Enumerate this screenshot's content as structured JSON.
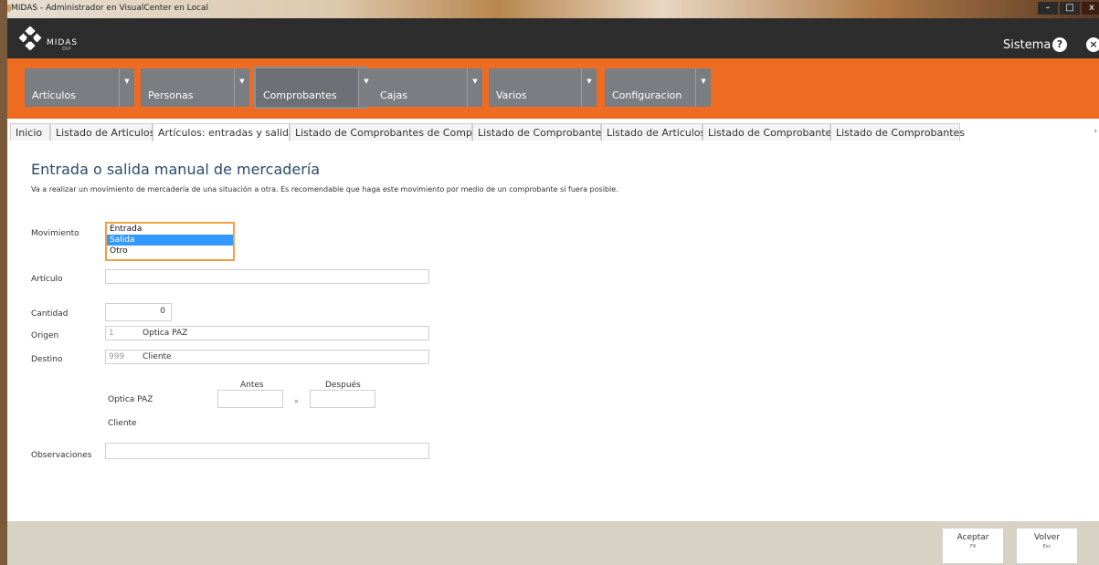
{
  "window": {
    "title": "MIDAS - Administrador en VisualCenter en Local",
    "controls": [
      "–",
      "□",
      "x"
    ]
  },
  "header": {
    "logo_text": "MIDAS",
    "logo_sub": "ERP",
    "sistema": "Sistema",
    "help": "?",
    "close": "×"
  },
  "menu": [
    {
      "label": "Artículos"
    },
    {
      "label": "Personas"
    },
    {
      "label": "Comprobantes"
    },
    {
      "label": "Cajas"
    },
    {
      "label": "Varios"
    },
    {
      "label": "Configuracion"
    }
  ],
  "menu_arrow": "▼",
  "tabs": [
    {
      "label": "Inicio"
    },
    {
      "label": "Listado de Articulos"
    },
    {
      "label": "Artículos: entradas y salidas"
    },
    {
      "label": "Listado de Comprobantes de Compras"
    },
    {
      "label": "Listado de Comprobantes"
    },
    {
      "label": "Listado de Articulos"
    },
    {
      "label": "Listado de Comprobantes"
    },
    {
      "label": "Listado de Comprobantes"
    }
  ],
  "tabs_scroll": "›",
  "form": {
    "title": "Entrada o salida manual de mercadería",
    "description": "Va a realizar un movimiento de mercadería de una situación a otra. Es recomendable que haga este movimiento por medio de un comprobante si fuera posible.",
    "movimiento_label": "Movimiento",
    "movimiento_options": [
      "Entrada",
      "Salida",
      "Otro"
    ],
    "movimiento_selected": "Salida",
    "articulo_label": "Artículo",
    "articulo_value": "",
    "cantidad_label": "Cantidad",
    "cantidad_value": "0",
    "origen_label": "Origen",
    "origen_code": "1",
    "origen_name": "Optica PAZ",
    "destino_label": "Destino",
    "destino_code": "999",
    "destino_name": "Cliente",
    "antes_label": "Antes",
    "despues_label": "Después",
    "stock_origen_name": "Optica PAZ",
    "arrow": "»",
    "stock_destino_name": "Cliente",
    "observaciones_label": "Observaciones",
    "observaciones_value": ""
  },
  "actions": {
    "aceptar": "Aceptar",
    "aceptar_key": "F9",
    "volver": "Volver",
    "volver_key": "Esc"
  },
  "colors": {
    "accent": "#ee6c22",
    "header": "#2d2d2d",
    "selection": "#3399ff",
    "title": "#2a4a6e"
  }
}
